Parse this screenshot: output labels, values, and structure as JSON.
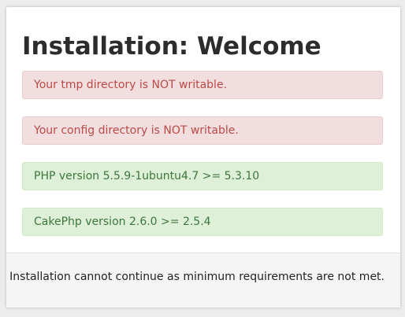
{
  "page": {
    "title": "Installation: Welcome"
  },
  "checks": [
    {
      "status": "error",
      "message": "Your tmp directory is NOT writable."
    },
    {
      "status": "error",
      "message": "Your config directory is NOT writable."
    },
    {
      "status": "ok",
      "message": "PHP version 5.5.9-1ubuntu4.7 >= 5.3.10"
    },
    {
      "status": "ok",
      "message": "CakePhp version 2.6.0 >= 2.5.4"
    }
  ],
  "footer": {
    "message": "Installation cannot continue as minimum requirements are not met."
  },
  "colors": {
    "error_bg": "#f2dede",
    "error_text": "#b94a48",
    "success_bg": "#dff0d8",
    "success_text": "#3c763d"
  }
}
